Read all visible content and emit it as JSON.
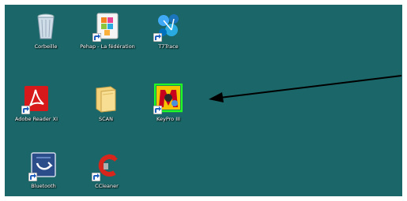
{
  "desktop": {
    "background_color": "#1a6668",
    "icons": [
      {
        "label": "Corbeille",
        "icon": "recycle-bin-icon"
      },
      {
        "label": "Pehap - La fédération",
        "icon": "app-shortcut-icon"
      },
      {
        "label": "T7Trace",
        "icon": "network-app-icon"
      },
      {
        "label": "Adobe Reader XI",
        "icon": "adobe-reader-icon"
      },
      {
        "label": "SCAN",
        "icon": "folder-icon"
      },
      {
        "label": "KeyPro III",
        "icon": "keypro-icon"
      },
      {
        "label": "Bluetooth",
        "icon": "bluetooth-icon"
      },
      {
        "label": "CCleaner",
        "icon": "ccleaner-icon"
      }
    ]
  },
  "annotation": {
    "arrow_color": "#000000",
    "highlight_color": "#22ff22"
  }
}
